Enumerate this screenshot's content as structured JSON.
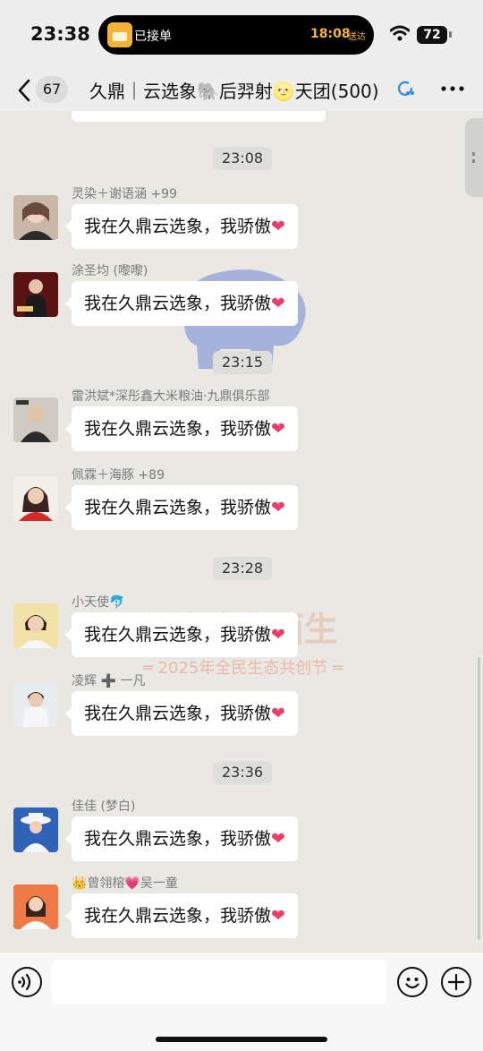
{
  "status_bar": {
    "time": "23:38",
    "island_label": "已接单",
    "island_time": "18:08",
    "island_sub": "送达",
    "battery": "72"
  },
  "nav": {
    "unread_count": "67",
    "title": "久鼎｜云选象🐘后羿射🌝天团(500)"
  },
  "watermark": {
    "text": "你的消费面生",
    "subtext": "═ 2025年全民生态共创节 ═"
  },
  "timestamps": [
    "23:08",
    "23:15",
    "23:28",
    "23:36"
  ],
  "messages": [
    {
      "sender": "灵染＋谢语涵 +99",
      "text": "我在久鼎云选象，我骄傲",
      "heart": "❤"
    },
    {
      "sender": "涂圣均 (嚟嚟)",
      "text": "我在久鼎云选象，我骄傲",
      "heart": "❤"
    },
    {
      "sender": "雷洪斌*深彤鑫大米粮油·九鼎俱乐部",
      "text": "我在久鼎云选象，我骄傲",
      "heart": "❤"
    },
    {
      "sender": "佩霖＋海豚 +89",
      "text": "我在久鼎云选象，我骄傲",
      "heart": "❤"
    },
    {
      "sender": "小天使🐬",
      "text": "我在久鼎云选象，我骄傲",
      "heart": "❤"
    },
    {
      "sender": "凌辉 ➕ 一凡",
      "text": "我在久鼎云选象，我骄傲",
      "heart": "❤"
    },
    {
      "sender": "佳佳 (梦白)",
      "text": "我在久鼎云选象，我骄傲",
      "heart": "❤"
    },
    {
      "sender": "👑曾翎榕💗吴一童",
      "text": "我在久鼎云选象，我骄傲",
      "heart": "❤"
    }
  ],
  "icons": {
    "back": "chevron-left-icon",
    "more": "more-dots-icon",
    "voice": "voice-icon",
    "emoji": "emoji-icon",
    "plus": "plus-icon"
  },
  "colors": {
    "chat_bg": "#e9e8e2",
    "bubble": "#ffffff",
    "heart": "#ec3f68",
    "watermark_elephant": "#6f88d8"
  }
}
